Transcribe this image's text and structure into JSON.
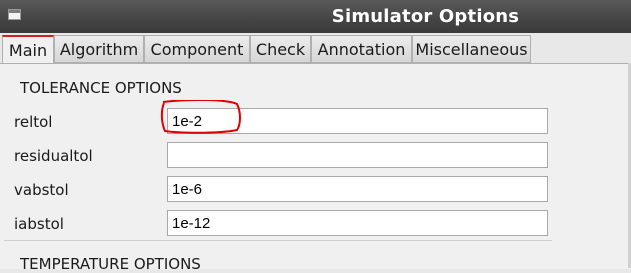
{
  "window": {
    "title": "Simulator Options"
  },
  "tabs": [
    "Main",
    "Algorithm",
    "Component",
    "Check",
    "Annotation",
    "Miscellaneous"
  ],
  "tolerance": {
    "heading": "TOLERANCE OPTIONS",
    "rows": [
      {
        "label": "reltol",
        "value": "1e-2"
      },
      {
        "label": "residualtol",
        "value": ""
      },
      {
        "label": "vabstol",
        "value": "1e-6"
      },
      {
        "label": "iabstol",
        "value": "1e-12"
      }
    ]
  },
  "temperature": {
    "heading": "TEMPERATURE OPTIONS"
  },
  "colors": {
    "titlebar": "#444444",
    "annotation_circle": "#e00000",
    "active_tab_accent": "#d02020"
  },
  "icons": {
    "window": "window-icon"
  }
}
